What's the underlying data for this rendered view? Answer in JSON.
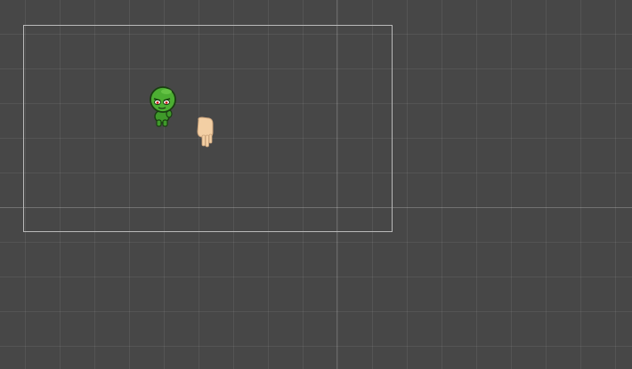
{
  "scene": {
    "background_color": "#474747",
    "grid_color": "#5a5a5a",
    "camera_border_color": "#b9b9b9",
    "sprites": [
      {
        "name": "zombie-character",
        "icon": "green-zombie-icon",
        "color": "#3f9a2a"
      },
      {
        "name": "hand-sprite",
        "icon": "hand-icon",
        "color": "#f3cfa4"
      }
    ]
  }
}
